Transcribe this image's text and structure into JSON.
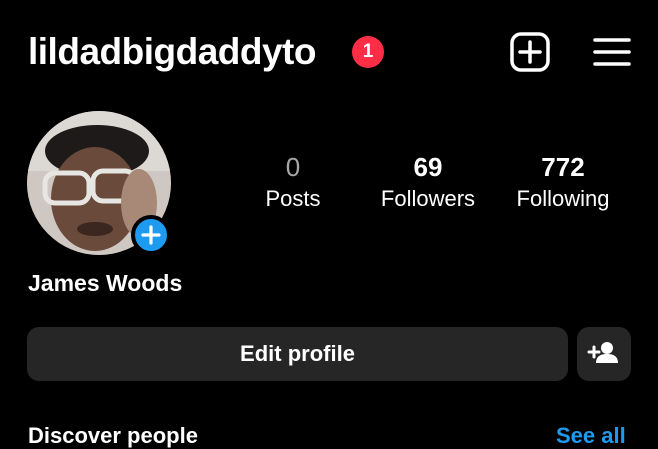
{
  "header": {
    "username": "lildadbigdaddyto",
    "notification_count": "1",
    "new_post_icon": "plus-square-icon",
    "menu_icon": "hamburger-menu-icon"
  },
  "profile": {
    "display_name": "James Woods",
    "stats": [
      {
        "value": "0",
        "label": "Posts"
      },
      {
        "value": "69",
        "label": "Followers"
      },
      {
        "value": "772",
        "label": "Following"
      }
    ]
  },
  "actions": {
    "edit_profile_label": "Edit profile",
    "add_person_icon": "add-person-icon"
  },
  "discover": {
    "title": "Discover people",
    "see_all_label": "See all"
  },
  "colors": {
    "background": "#000000",
    "button_bg": "#262626",
    "notification_badge": "#ff2d46",
    "accent_blue": "#1d9bf0",
    "muted_text": "#a8a8a8"
  }
}
